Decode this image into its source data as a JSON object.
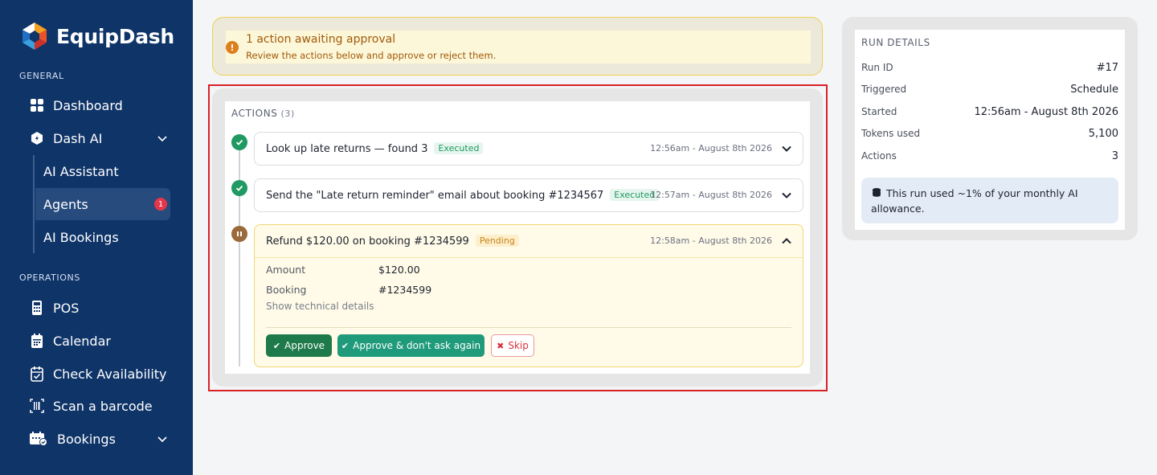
{
  "brand": {
    "name": "EquipDash"
  },
  "sidebar": {
    "general_label": "GENERAL",
    "operations_label": "OPERATIONS",
    "items": {
      "dashboard": "Dashboard",
      "dash_ai": "Dash AI",
      "ai_assistant": "AI Assistant",
      "agents": "Agents",
      "agents_badge": "1",
      "ai_bookings": "AI Bookings",
      "pos": "POS",
      "calendar": "Calendar",
      "check_availability": "Check Availability",
      "scan_barcode": "Scan a barcode",
      "bookings": "Bookings"
    }
  },
  "alert": {
    "title": "1 action awaiting approval",
    "subtitle": "Review the actions below and approve or reject them."
  },
  "actions": {
    "heading": "ACTIONS",
    "count": "(3)",
    "items": [
      {
        "title": "Look up late returns — found 3",
        "status": "Executed",
        "time": "12:56am - August 8th 2026"
      },
      {
        "title": "Send the \"Late return reminder\" email about booking #1234567",
        "status": "Executed",
        "time": "12:57am - August 8th 2026"
      },
      {
        "title": "Refund $120.00 on booking #1234599",
        "status": "Pending",
        "time": "12:58am - August 8th 2026"
      }
    ],
    "details": {
      "amount_label": "Amount",
      "amount_value": "$120.00",
      "booking_label": "Booking",
      "booking_value": "#1234599",
      "technical_link": "Show technical details"
    },
    "buttons": {
      "approve": "Approve",
      "approve_always": "Approve & don't ask again",
      "skip": "Skip"
    }
  },
  "run_details": {
    "title": "RUN DETAILS",
    "rows": [
      {
        "label": "Run ID",
        "value": "#17"
      },
      {
        "label": "Triggered",
        "value": "Schedule"
      },
      {
        "label": "Started",
        "value": "12:56am - August 8th 2026"
      },
      {
        "label": "Tokens used",
        "value": "5,100"
      },
      {
        "label": "Actions",
        "value": "3"
      }
    ],
    "note": "This run used ~1% of your monthly AI allowance."
  },
  "colors": {
    "sidebar_bg": "#0f3468",
    "executed_green": "#1f9a62",
    "pending_amber": "#c7861a",
    "highlight_red": "#d92228"
  }
}
